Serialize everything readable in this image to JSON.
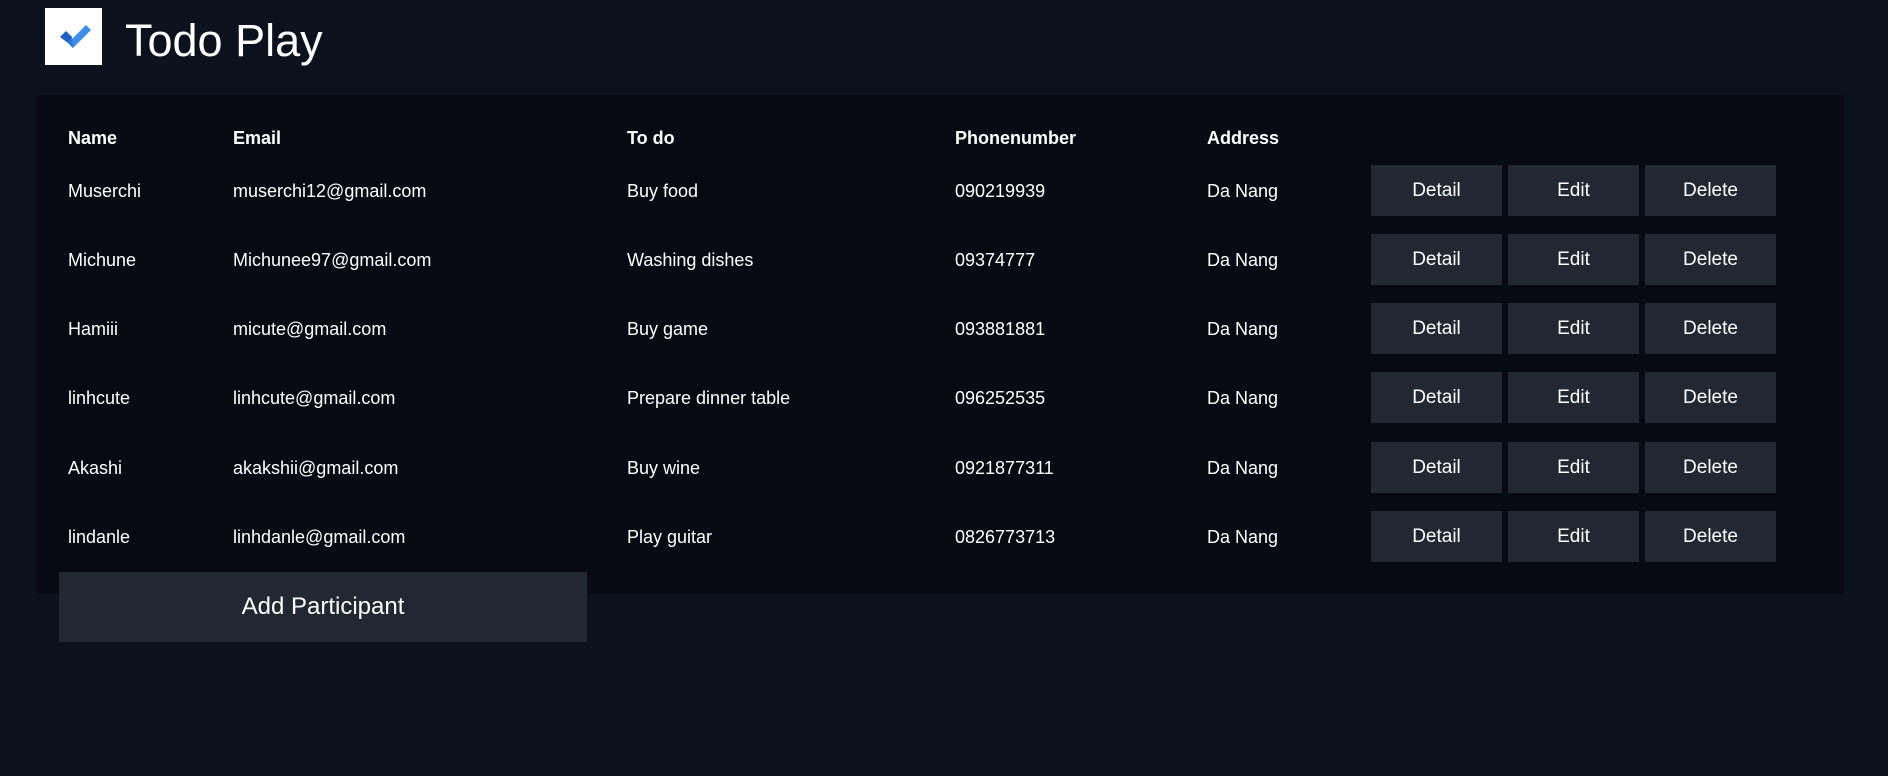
{
  "app": {
    "title": "Todo Play",
    "logo_icon": "checkmark-icon",
    "accent_colors": {
      "check_dark": "#1e5fbf",
      "check_light": "#3d8ee8"
    }
  },
  "table": {
    "headers": {
      "name": "Name",
      "email": "Email",
      "todo": "To do",
      "phone": "Phonenumber",
      "address": "Address"
    },
    "rows": [
      {
        "name": "Muserchi",
        "email": "muserchi12@gmail.com",
        "todo": "Buy food",
        "phone": "090219939",
        "address": "Da Nang"
      },
      {
        "name": "Michune",
        "email": "Michunee97@gmail.com",
        "todo": "Washing dishes",
        "phone": "09374777",
        "address": "Da Nang"
      },
      {
        "name": "Hamiii",
        "email": "micute@gmail.com",
        "todo": "Buy game",
        "phone": "093881881",
        "address": "Da Nang"
      },
      {
        "name": "linhcute",
        "email": "linhcute@gmail.com",
        "todo": "Prepare dinner table",
        "phone": "096252535",
        "address": "Da Nang"
      },
      {
        "name": "Akashi",
        "email": "akakshii@gmail.com",
        "todo": "Buy wine",
        "phone": "0921877311",
        "address": "Da Nang"
      },
      {
        "name": "lindanle",
        "email": "linhdanle@gmail.com",
        "todo": "Play guitar",
        "phone": "0826773713",
        "address": "Da Nang"
      }
    ],
    "actions": {
      "detail": "Detail",
      "edit": "Edit",
      "delete": "Delete"
    }
  },
  "add_button_label": "Add Participant"
}
